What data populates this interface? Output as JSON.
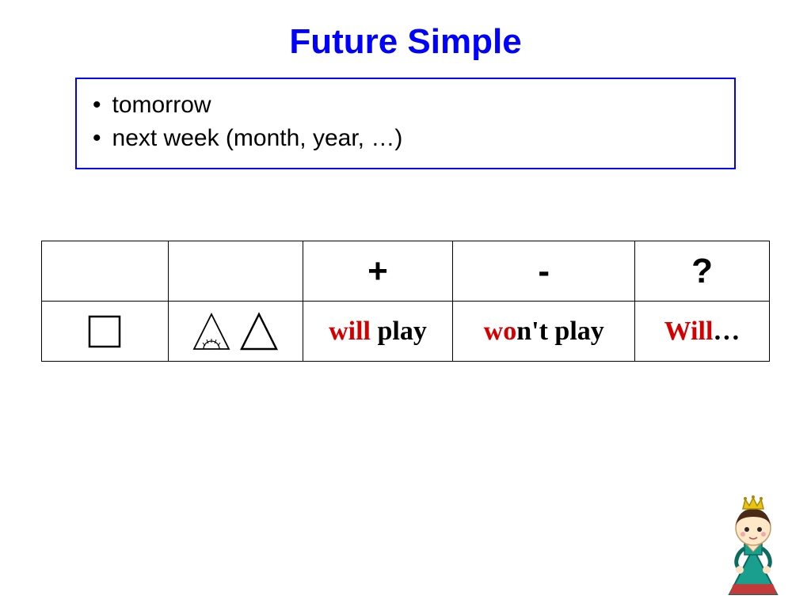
{
  "title": "Future Simple",
  "markers": {
    "items": [
      "tomorrow",
      "next week (month, year, …)"
    ]
  },
  "table": {
    "headers": {
      "plus": "+",
      "minus": "-",
      "question": "?"
    },
    "row1": {
      "pos_will": "will",
      "pos_verb": " play",
      "neg_wo": "wo",
      "neg_rest": "n't play",
      "q_will": "Will",
      "q_dots": "…"
    }
  }
}
